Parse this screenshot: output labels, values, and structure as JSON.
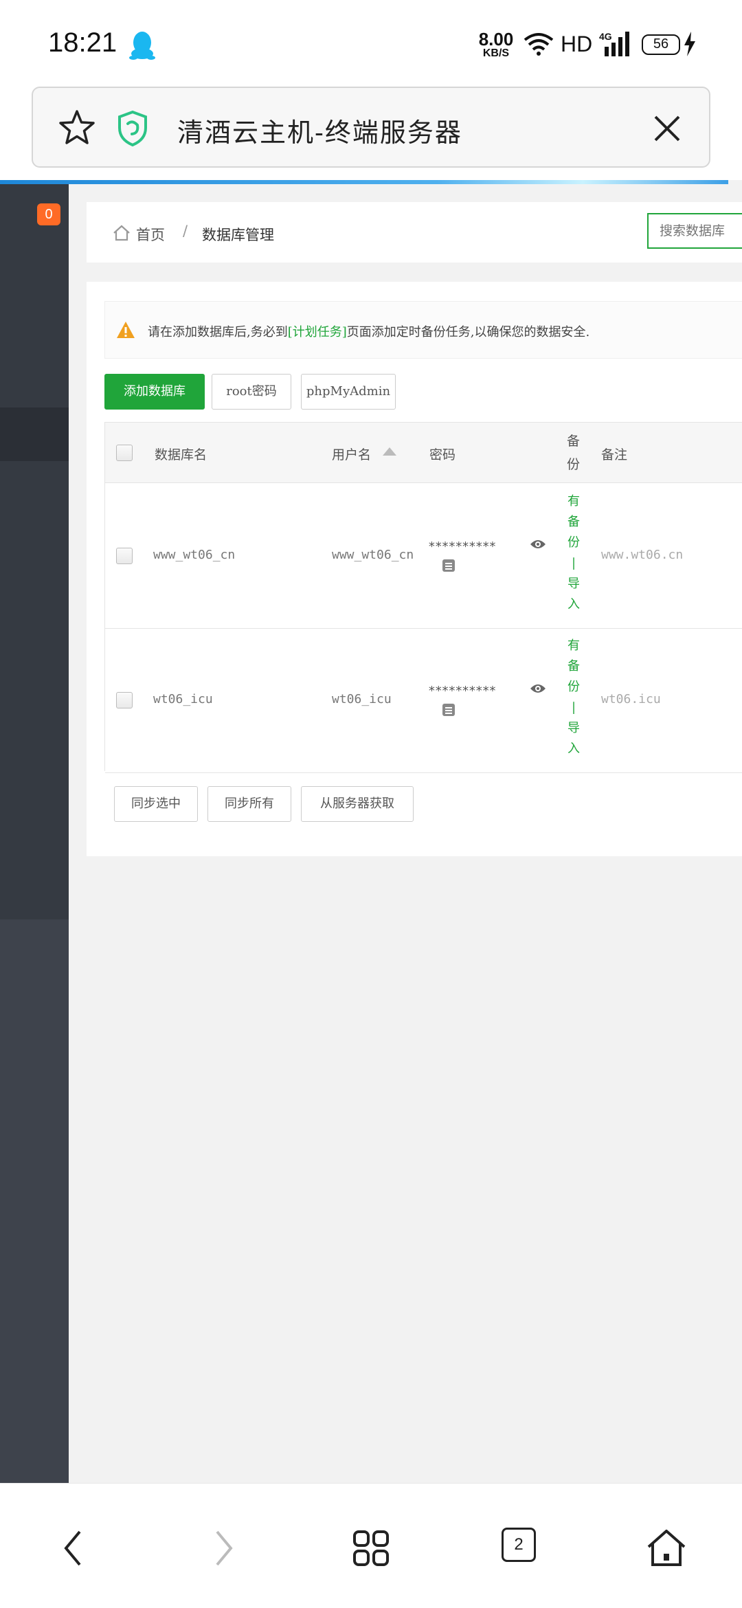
{
  "status_bar": {
    "time": "18:21",
    "net_speed_value": "8.00",
    "net_speed_unit": "KB/S",
    "hd_label": "HD",
    "network_label": "4G",
    "battery_level": "56"
  },
  "browser": {
    "title": "清酒云主机-终端服务器",
    "tab_count": "2"
  },
  "sidebar": {
    "badge_count": "0"
  },
  "breadcrumb": {
    "home": "首页",
    "separator": "/",
    "current": "数据库管理"
  },
  "search": {
    "placeholder": "搜索数据库"
  },
  "notice": {
    "prefix": "请在添加数据库后,务必到",
    "link": "[计划任务]",
    "suffix": "页面添加定时备份任务,以确保您的数据安全."
  },
  "toolbar": {
    "add_label": "添加数据库",
    "root_label": "root密码",
    "phpmyadmin_label": "phpMyAdmin"
  },
  "table": {
    "headers": {
      "name": "数据库名",
      "user": "用户名",
      "password": "密码",
      "backup": "备份",
      "remark": "备注"
    },
    "rows": [
      {
        "name": "www_wt06_cn",
        "user": "www_wt06_cn",
        "password": "**********",
        "backup_status": "有备份",
        "backup_sep": "|",
        "import_label": "导入",
        "remark": "www.wt06.cn"
      },
      {
        "name": "wt06_icu",
        "user": "wt06_icu",
        "password": "**********",
        "backup_status": "有备份",
        "backup_sep": "|",
        "import_label": "导入",
        "remark": "wt06.icu"
      }
    ]
  },
  "bottom_actions": {
    "sync_selected": "同步选中",
    "sync_all": "同步所有",
    "fetch_from_server": "从服务器获取"
  },
  "colors": {
    "accent_green": "#20a53a",
    "badge_orange": "#ff6b26",
    "sidebar_dark": "#3e434c"
  }
}
